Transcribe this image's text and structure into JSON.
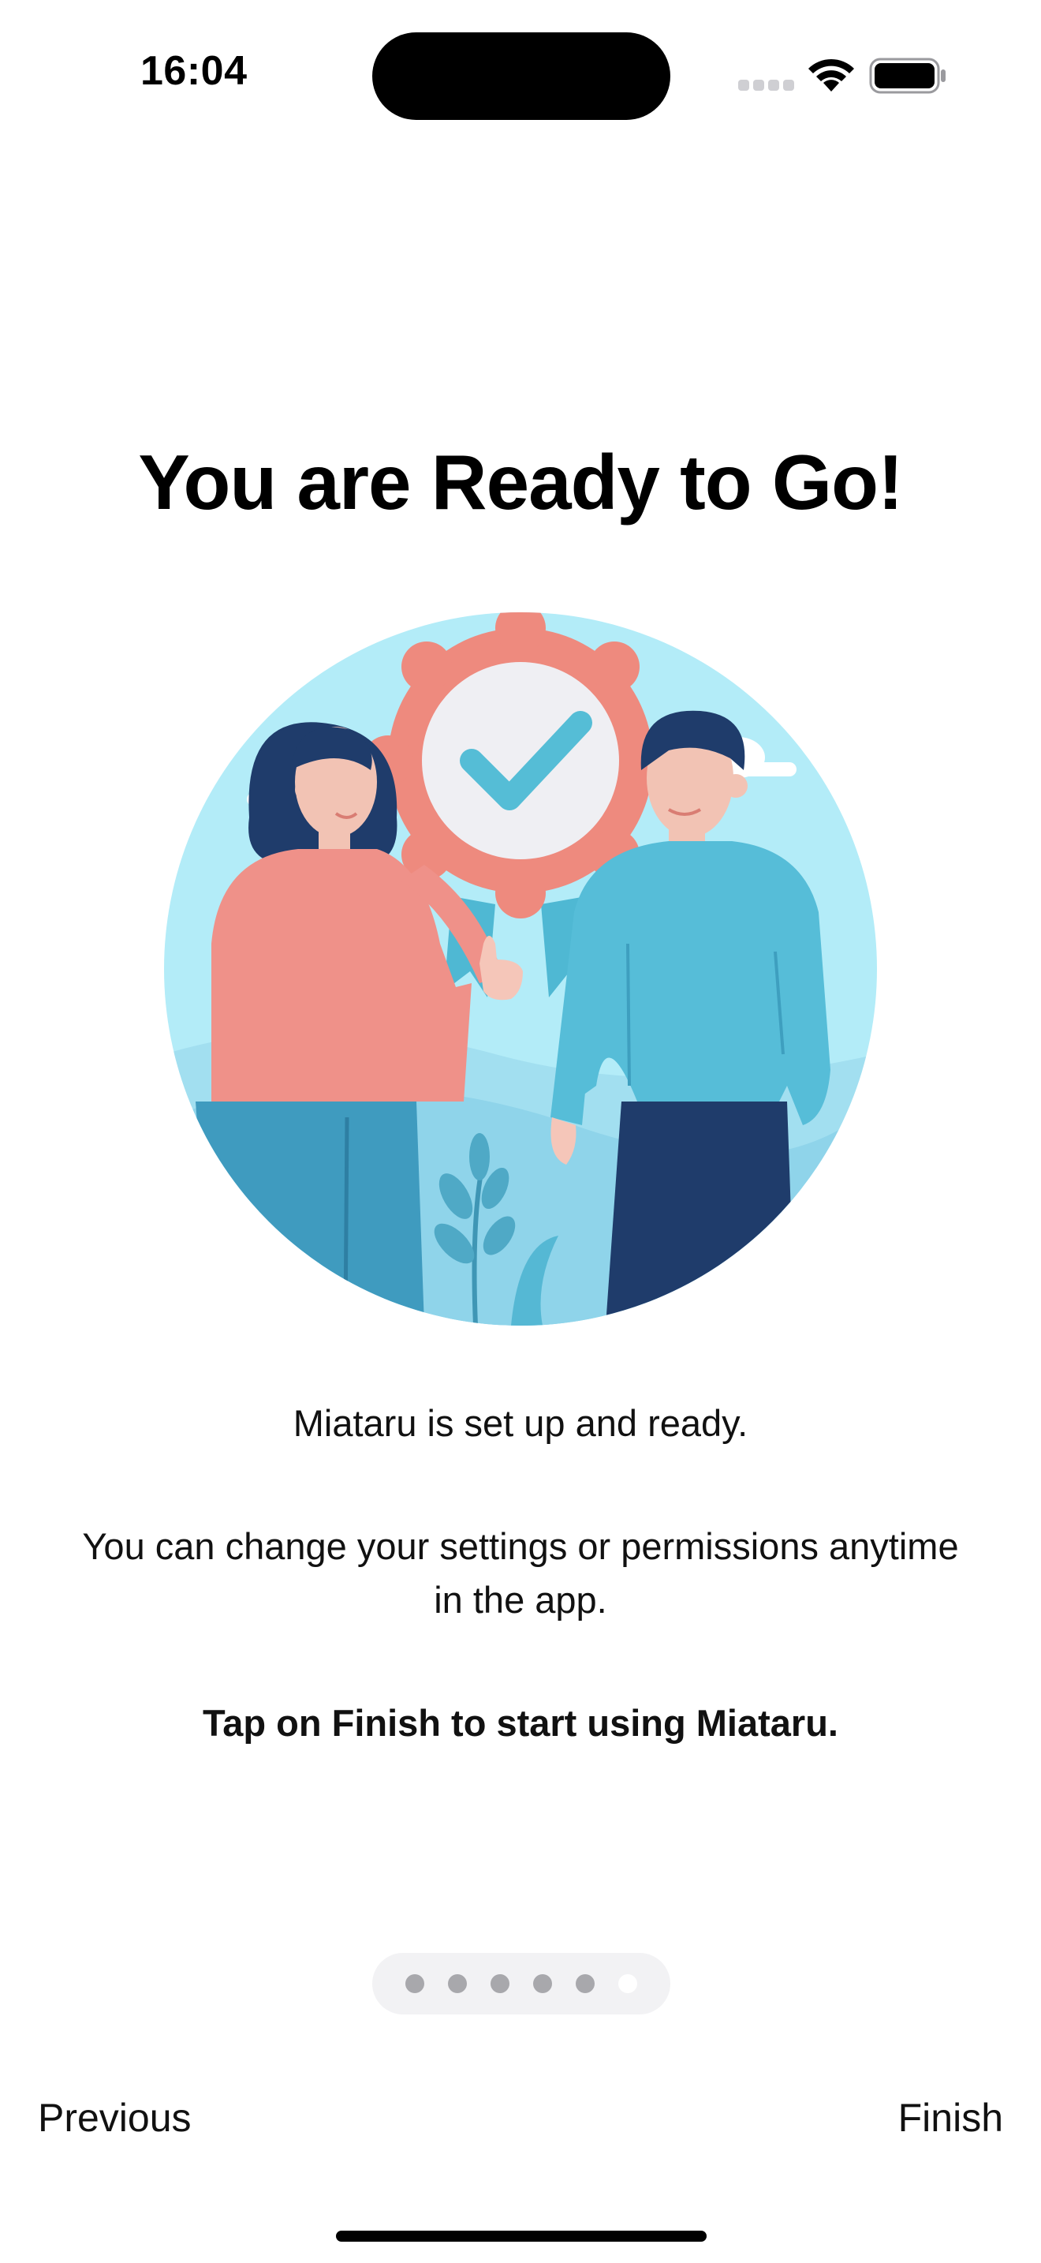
{
  "status_bar": {
    "time": "16:04",
    "icons": [
      "cellular-signal-icon",
      "wifi-icon",
      "battery-icon"
    ]
  },
  "onboarding": {
    "title": "You are Ready to Go!",
    "illustration": "two-people-with-checkmark-badge-illustration",
    "text_1": "Miataru is set up and ready.",
    "text_2": "You can change your settings or permissions anytime in the app.",
    "text_3": "Tap on Finish to start using Miataru.",
    "pages_total": 6,
    "current_page": 6
  },
  "navigation": {
    "previous_label": "Previous",
    "finish_label": "Finish"
  },
  "colors": {
    "sky": "#b3ecf8",
    "badge": "#ee8a7e",
    "check": "#55bdd6",
    "woman_shirt": "#ef9189",
    "man_shirt": "#56bdd8",
    "hair": "#1f3c6b"
  }
}
